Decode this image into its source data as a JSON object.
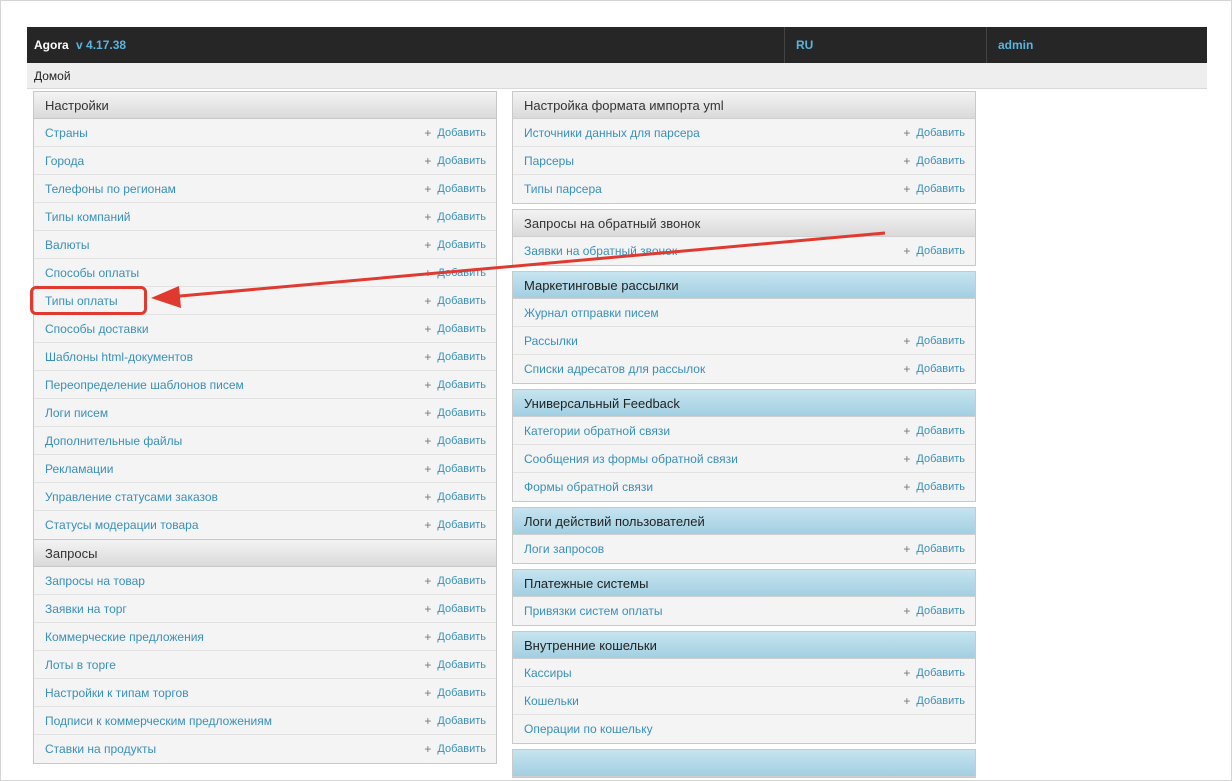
{
  "header": {
    "app_name": "Agora",
    "version": "v 4.17.38",
    "language": "RU",
    "user": "admin"
  },
  "breadcrumb": "Домой",
  "add_label": "Добавить",
  "plus_icon": "+",
  "left_column": [
    {
      "caption": "Настройки",
      "items": [
        {
          "label": "Страны",
          "add": true
        },
        {
          "label": "Города",
          "add": true
        },
        {
          "label": "Телефоны по регионам",
          "add": true
        },
        {
          "label": "Типы компаний",
          "add": true
        },
        {
          "label": "Валюты",
          "add": true
        },
        {
          "label": "Способы оплаты",
          "add": true
        },
        {
          "label": "Типы оплаты",
          "add": true
        },
        {
          "label": "Способы доставки",
          "add": true
        },
        {
          "label": "Шаблоны html-документов",
          "add": true
        },
        {
          "label": "Переопределение шаблонов писем",
          "add": true
        },
        {
          "label": "Логи писем",
          "add": true
        },
        {
          "label": "Дополнительные файлы",
          "add": true
        },
        {
          "label": "Рекламации",
          "add": true
        },
        {
          "label": "Управление статусами заказов",
          "add": true
        },
        {
          "label": "Статусы модерации товара",
          "add": true
        }
      ]
    },
    {
      "caption": "Запросы",
      "items": [
        {
          "label": "Запросы на товар",
          "add": true
        },
        {
          "label": "Заявки на торг",
          "add": true
        },
        {
          "label": "Коммерческие предложения",
          "add": true
        },
        {
          "label": "Лоты в торге",
          "add": true
        },
        {
          "label": "Настройки к типам торгов",
          "add": true
        },
        {
          "label": "Подписи к коммерческим предложениям",
          "add": true
        },
        {
          "label": "Ставки на продукты",
          "add": true
        }
      ]
    }
  ],
  "right_column": [
    {
      "caption": "Настройка формата импорта yml",
      "style": "grey",
      "items": [
        {
          "label": "Источники данных для парсера",
          "add": true
        },
        {
          "label": "Парсеры",
          "add": true
        },
        {
          "label": "Типы парсера",
          "add": true
        }
      ]
    },
    {
      "caption": "Запросы на обратный звонок",
      "style": "grey",
      "items": [
        {
          "label": "Заявки на обратный звонок",
          "add": true
        }
      ]
    },
    {
      "caption": "Маркетинговые рассылки",
      "style": "blue",
      "items": [
        {
          "label": "Журнал отправки писем",
          "add": false
        },
        {
          "label": "Рассылки",
          "add": true
        },
        {
          "label": "Списки адресатов для рассылок",
          "add": true
        }
      ]
    },
    {
      "caption": "Универсальный Feedback",
      "style": "blue",
      "items": [
        {
          "label": "Категории обратной связи",
          "add": true
        },
        {
          "label": "Сообщения из формы обратной связи",
          "add": true
        },
        {
          "label": "Формы обратной связи",
          "add": true
        }
      ]
    },
    {
      "caption": "Логи действий пользователей",
      "style": "blue",
      "items": [
        {
          "label": "Логи запросов",
          "add": true
        }
      ]
    },
    {
      "caption": "Платежные системы",
      "style": "blue",
      "items": [
        {
          "label": "Привязки систем оплаты",
          "add": true
        }
      ]
    },
    {
      "caption": "Внутренние кошельки",
      "style": "blue",
      "items": [
        {
          "label": "Кассиры",
          "add": true
        },
        {
          "label": "Кошельки",
          "add": true
        },
        {
          "label": "Операции по кошельку",
          "add": false
        }
      ]
    },
    {
      "caption": "",
      "style": "blue",
      "items": []
    }
  ],
  "annotation": {
    "color": "#e03a30",
    "highlighted_item": "Типы оплаты"
  }
}
